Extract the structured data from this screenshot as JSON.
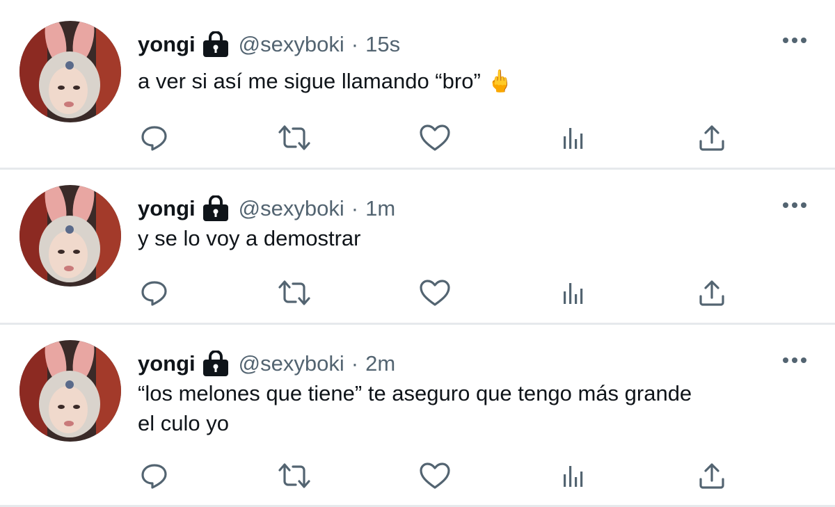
{
  "tweets": [
    {
      "name": "yongi",
      "handle": "@sexyboki",
      "separator": "·",
      "time": "15s",
      "text": "a ver si así me sigue llamando “bro” 🖕",
      "emoji": "🖕"
    },
    {
      "name": "yongi",
      "handle": "@sexyboki",
      "separator": "·",
      "time": "1m",
      "text": "y se lo voy a demostrar"
    },
    {
      "name": "yongi",
      "handle": "@sexyboki",
      "separator": "·",
      "time": "2m",
      "text_line1": "“los melones que tiene” te aseguro que tengo más grande",
      "text_line2": "el culo yo"
    }
  ],
  "icons": {
    "lock": "lock-icon",
    "more": "more-icon",
    "reply": "reply-icon",
    "retweet": "retweet-icon",
    "like": "heart-icon",
    "views": "analytics-icon",
    "share": "share-icon"
  },
  "colors": {
    "text": "#0f1419",
    "secondary": "#536471",
    "divider": "#e6e9ec"
  }
}
